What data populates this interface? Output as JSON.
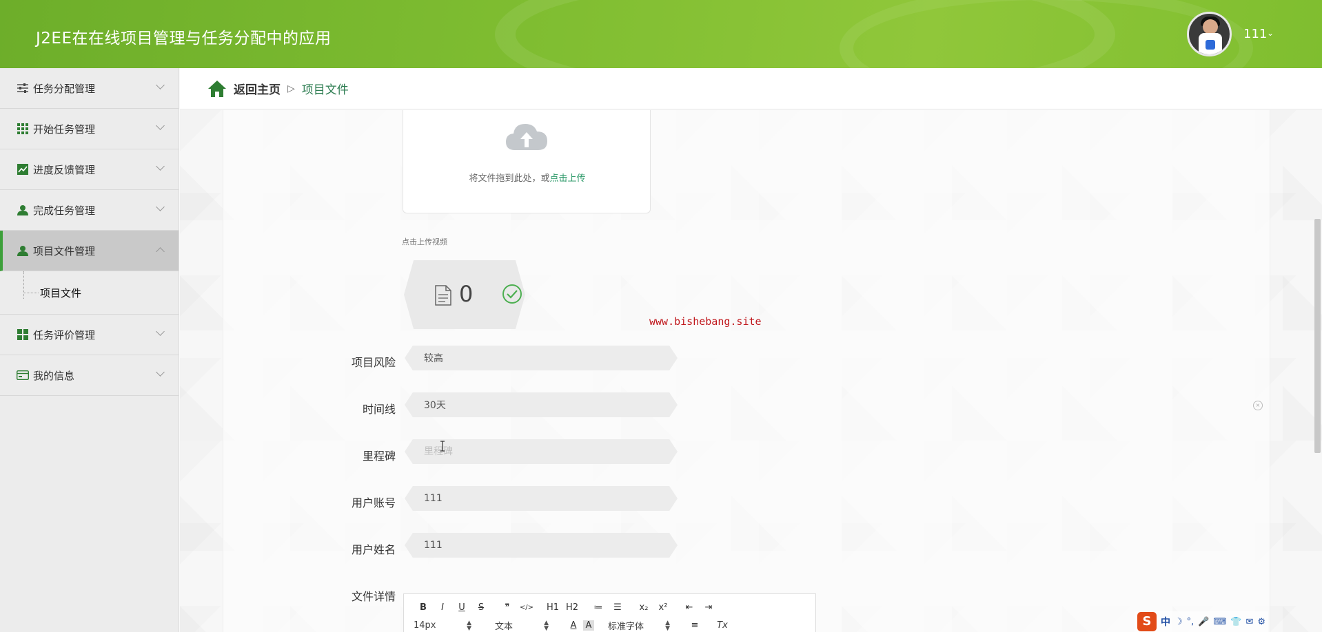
{
  "header": {
    "title": "J2EE在在线项目管理与任务分配中的应用",
    "user_name": "111",
    "user_caret": "⌄"
  },
  "sidebar": {
    "items": [
      {
        "label": "任务分配管理",
        "icon": "sliders-icon"
      },
      {
        "label": "开始任务管理",
        "icon": "grid-icon"
      },
      {
        "label": "进度反馈管理",
        "icon": "chart-line-icon"
      },
      {
        "label": "完成任务管理",
        "icon": "user-icon"
      },
      {
        "label": "项目文件管理",
        "icon": "user-icon",
        "active": true
      },
      {
        "label": "任务评价管理",
        "icon": "tiles-icon"
      },
      {
        "label": "我的信息",
        "icon": "card-icon"
      }
    ],
    "sub_item": "项目文件"
  },
  "breadcrumb": {
    "home": "返回主页",
    "separator": "▷",
    "current": "项目文件"
  },
  "upload": {
    "text": "将文件拖到此处，或",
    "link": "点击上传"
  },
  "video": {
    "caption": "点击上传视频",
    "count": "0"
  },
  "watermark": "www.bishebang.site",
  "form": {
    "risk_label": "项目风险",
    "risk_value": "较高",
    "timeline_label": "时间线",
    "timeline_value": "30天",
    "milestone_label": "里程碑",
    "milestone_placeholder": "里程碑",
    "account_label": "用户账号",
    "account_value": "111",
    "name_label": "用户姓名",
    "name_value": "111",
    "detail_label": "文件详情"
  },
  "editor": {
    "row1": [
      "B",
      "I",
      "U",
      "S",
      "❞",
      "</>",
      "H1",
      "H2",
      "≔",
      "☰",
      "x₂",
      "x²",
      "⇤",
      "⇥"
    ],
    "font_size": "14px",
    "text_style": "文本",
    "font_family": "标准字体",
    "color_icon": "A",
    "bg_icon": "A",
    "align_icon": "≡",
    "clear_icon": "Tx"
  },
  "ime": {
    "logo": "S",
    "lang": "中",
    "icons": [
      "☽",
      "°,",
      "🎤",
      "⌨",
      "👕",
      "✉",
      "⚙"
    ]
  }
}
